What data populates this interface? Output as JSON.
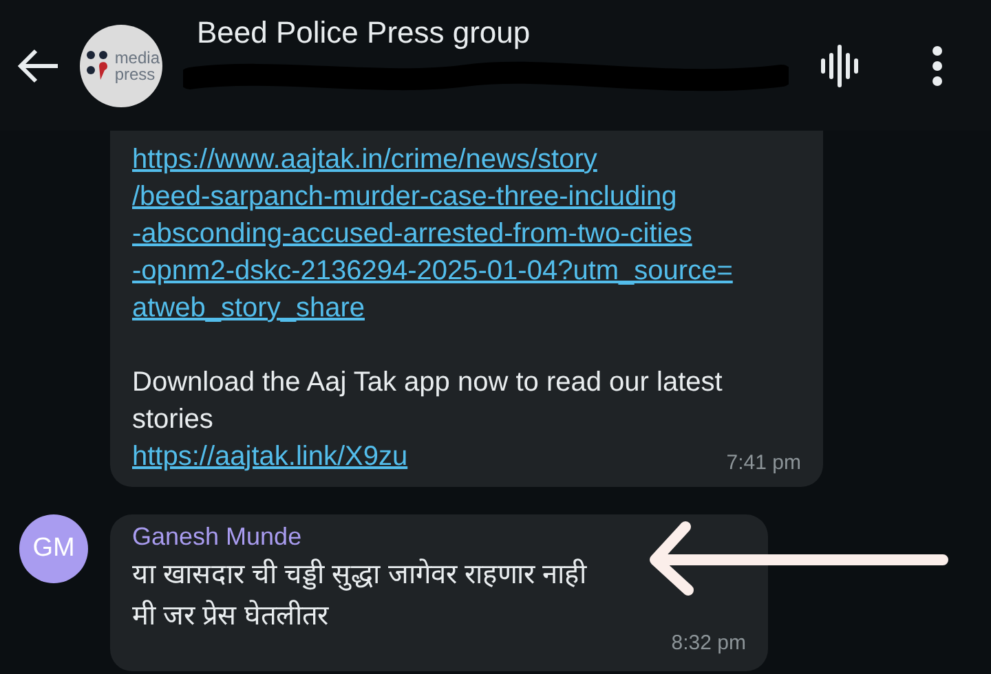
{
  "header": {
    "title": "Beed Police Press group",
    "logo_lines": [
      "media",
      "press"
    ]
  },
  "messages": [
    {
      "kind": "continued",
      "link_lines": [
        "https://www.aajtak.in/crime/news/story",
        "/beed-sarpanch-murder-case-three-including",
        "-absconding-accused-arrested-from-two-cities",
        "-opnm2-dskc-2136294-2025-01-04?utm_source=",
        "atweb_story_share"
      ],
      "body": "Download the Aaj Tak app now to read our latest stories",
      "link2": "https://aajtak.link/X9zu",
      "time": "7:41 pm"
    },
    {
      "kind": "with_sender",
      "initials": "GM",
      "sender": "Ganesh Munde",
      "color": "#a99cf0",
      "lines": [
        "या खासदार ची चड्डी सुद्धा जागेवर राहणार नाही",
        "मी जर प्रेस घेतलीतर"
      ],
      "time": "8:32 pm"
    }
  ]
}
